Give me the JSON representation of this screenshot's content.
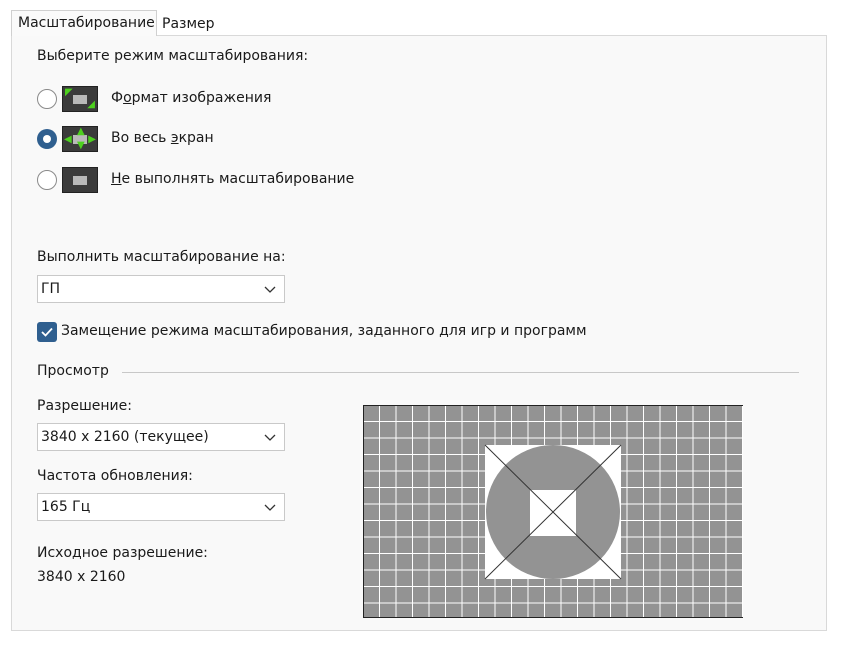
{
  "tabs": [
    {
      "label": "Масштабирование",
      "active": true
    },
    {
      "label": "Размер",
      "active": false
    }
  ],
  "scaling_mode": {
    "heading": "Выберите режим масштабирования:",
    "options": [
      {
        "pre": "Ф",
        "acc": "о",
        "post": "рмат изображения",
        "selected": false,
        "icon": "aspect-ratio-icon"
      },
      {
        "pre": "Во весь ",
        "acc": "э",
        "post": "кран",
        "selected": true,
        "icon": "full-screen-icon"
      },
      {
        "pre": "",
        "acc": "Н",
        "post": "е выполнять масштабирование",
        "selected": false,
        "icon": "no-scaling-icon"
      }
    ]
  },
  "perform_on": {
    "label": "Выполнить масштабирование на:",
    "value": "ГП"
  },
  "override": {
    "label": "Замещение режима масштабирования, заданного для игр и программ",
    "checked": true
  },
  "preview": {
    "section_label": "Просмотр",
    "resolution_label": "Разрешение:",
    "resolution_value": "3840 x 2160 (текущее)",
    "refresh_label": "Частота обновления:",
    "refresh_value": "165 Гц",
    "native_label": "Исходное разрешение:",
    "native_value": "3840 x 2160"
  },
  "colors": {
    "accent": "#2f5f8f",
    "icon_arrow": "#4dd11e",
    "preview_gray": "#939393"
  }
}
